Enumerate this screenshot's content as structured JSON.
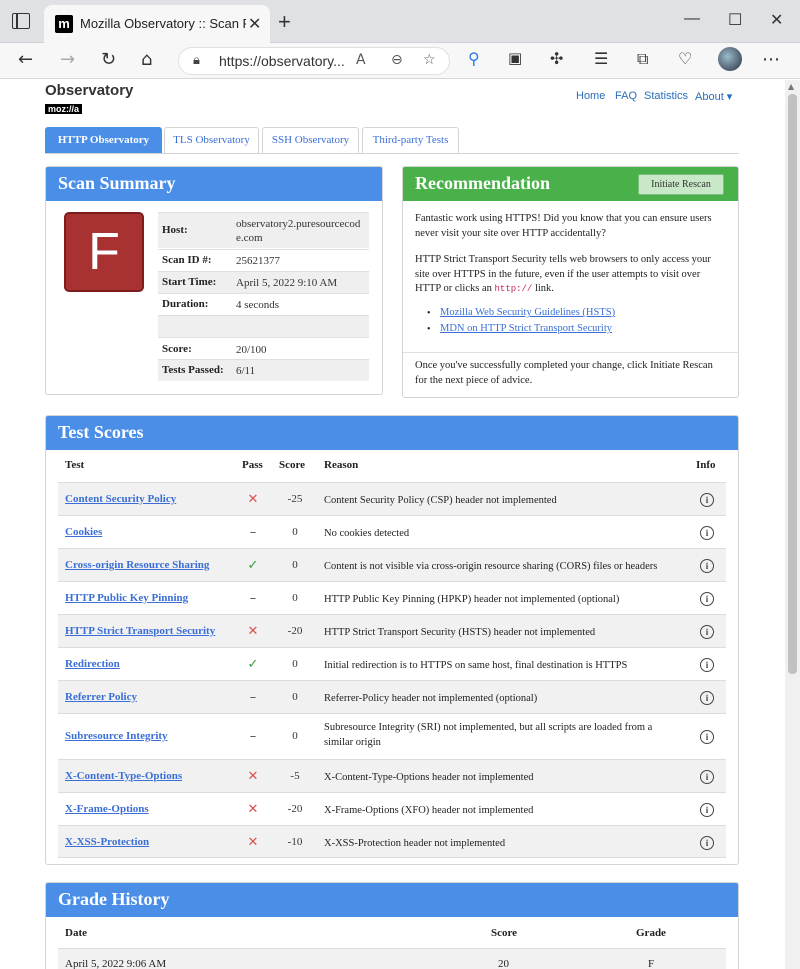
{
  "browser": {
    "tab_title": "Mozilla Observatory :: Scan Results",
    "favicon_letter": "m",
    "url": "https://observatory...",
    "new_tab": "+",
    "close": "✕",
    "min": "—",
    "max": "☐",
    "close_window": "✕"
  },
  "site": {
    "title": "Observatory",
    "subtitle": "moz://a",
    "nav": [
      {
        "label": "Home"
      },
      {
        "label": "FAQ"
      },
      {
        "label": "Statistics"
      },
      {
        "label": "About ▾"
      }
    ]
  },
  "page_tabs": [
    {
      "label": "HTTP Observatory",
      "active": true
    },
    {
      "label": "TLS Observatory",
      "active": false
    },
    {
      "label": "SSH Observatory",
      "active": false
    },
    {
      "label": "Third-party Tests",
      "active": false
    }
  ],
  "summary": {
    "heading": "Scan Summary",
    "grade": "F",
    "grade_color": "#a83232",
    "rows": [
      {
        "label": "Host:",
        "value": "observatory2.puresourcecode.com"
      },
      {
        "label": "Scan ID #:",
        "value": "25621377"
      },
      {
        "label": "Start Time:",
        "value": "April 5, 2022 9:10 AM"
      },
      {
        "label": "Duration:",
        "value": "4 seconds"
      },
      {
        "label": "",
        "value": ""
      },
      {
        "label": "Score:",
        "value": "20/100"
      },
      {
        "label": "Tests Passed:",
        "value": "6/11"
      }
    ]
  },
  "recommendation": {
    "heading": "Recommendation",
    "button": "Initiate Rescan",
    "p1": "Fantastic work using HTTPS! Did you know that you can ensure users never visit your site over HTTP accidentally?",
    "p2_a": "HTTP Strict Transport Security tells web browsers to only access your site over HTTPS in the future, even if the user attempts to visit over HTTP or clicks an",
    "p2_code": "http://",
    "p2_b": "link.",
    "links": [
      {
        "label": "Mozilla Web Security Guidelines (HSTS)"
      },
      {
        "label": "MDN on HTTP Strict Transport Security"
      }
    ],
    "p3": "Once you've successfully completed your change, click Initiate Rescan for the next piece of advice."
  },
  "tests": {
    "heading": "Test Scores",
    "columns": {
      "test": "Test",
      "pass": "Pass",
      "score": "Score",
      "reason": "Reason",
      "info": "Info"
    },
    "rows": [
      {
        "name": "Content Security Policy",
        "pass": "✕",
        "status": "fail",
        "score": "-25",
        "reason": "Content Security Policy (CSP) header not implemented"
      },
      {
        "name": "Cookies",
        "pass": "–",
        "status": "na",
        "score": "0",
        "reason": "No cookies detected"
      },
      {
        "name": "Cross-origin Resource Sharing",
        "pass": "✓",
        "status": "ok",
        "score": "0",
        "reason": "Content is not visible via cross-origin resource sharing (CORS) files or headers"
      },
      {
        "name": "HTTP Public Key Pinning",
        "pass": "–",
        "status": "na",
        "score": "0",
        "reason": "HTTP Public Key Pinning (HPKP) header not implemented (optional)"
      },
      {
        "name": "HTTP Strict Transport Security",
        "pass": "✕",
        "status": "fail",
        "score": "-20",
        "reason": "HTTP Strict Transport Security (HSTS) header not implemented"
      },
      {
        "name": "Redirection",
        "pass": "✓",
        "status": "ok",
        "score": "0",
        "reason": "Initial redirection is to HTTPS on same host, final destination is HTTPS"
      },
      {
        "name": "Referrer Policy",
        "pass": "–",
        "status": "na",
        "score": "0",
        "reason": "Referrer-Policy header not implemented (optional)"
      },
      {
        "name": "Subresource Integrity",
        "pass": "–",
        "status": "na",
        "score": "0",
        "reason": "Subresource Integrity (SRI) not implemented, but all scripts are loaded from a similar origin"
      },
      {
        "name": "X-Content-Type-Options",
        "pass": "✕",
        "status": "fail",
        "score": "-5",
        "reason": "X-Content-Type-Options header not implemented"
      },
      {
        "name": "X-Frame-Options",
        "pass": "✕",
        "status": "fail",
        "score": "-20",
        "reason": "X-Frame-Options (XFO) header not implemented"
      },
      {
        "name": "X-XSS-Protection",
        "pass": "✕",
        "status": "fail",
        "score": "-10",
        "reason": "X-XSS-Protection header not implemented"
      }
    ],
    "info_glyph": "i"
  },
  "history": {
    "heading": "Grade History",
    "columns": {
      "date": "Date",
      "score": "Score",
      "grade": "Grade"
    },
    "rows": [
      {
        "date": "April 5, 2022 9:06 AM",
        "score": "20",
        "grade": "F"
      }
    ]
  }
}
